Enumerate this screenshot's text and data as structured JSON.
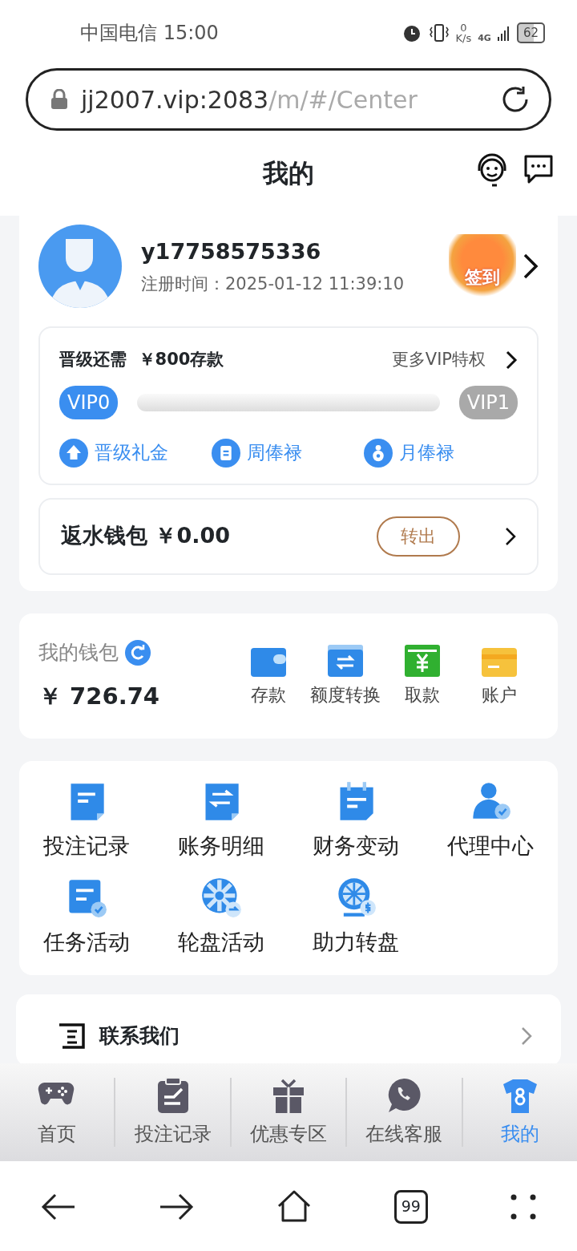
{
  "status_bar": {
    "carrier_time": "中国电信 15:00",
    "net_speed_value": "0",
    "net_speed_unit": "K/s",
    "network": "4G",
    "battery": "62"
  },
  "address_bar": {
    "host": "jj2007.vip:2083",
    "path": "/m/#/Center"
  },
  "header": {
    "title": "我的"
  },
  "profile": {
    "username": "y17758575336",
    "registered": "注册时间：2025-01-12 11:39:10",
    "sign_in": "签到"
  },
  "vip": {
    "need": "晋级还需  ￥800存款",
    "more": "更多VIP特权",
    "current": "VIP0",
    "next": "VIP1",
    "level": 0,
    "perks": [
      {
        "kind": "upgrade",
        "label": "晋级礼金"
      },
      {
        "kind": "weekly",
        "label": "周俸禄"
      },
      {
        "kind": "monthly",
        "label": "月俸禄"
      }
    ]
  },
  "rebate": {
    "label": "返水钱包 ￥0.00",
    "button": "转出"
  },
  "wallet": {
    "title": "我的钱包",
    "balance": "￥ 726.74",
    "actions": [
      {
        "kind": "deposit",
        "label": "存款"
      },
      {
        "kind": "transfer",
        "label": "额度转换"
      },
      {
        "kind": "withdraw",
        "label": "取款"
      },
      {
        "kind": "account",
        "label": "账户"
      }
    ]
  },
  "menu": [
    {
      "kind": "note",
      "label": "投注记录"
    },
    {
      "kind": "swap",
      "label": "账务明细"
    },
    {
      "kind": "calendar",
      "label": "财务变动"
    },
    {
      "kind": "agent",
      "label": "代理中心"
    },
    {
      "kind": "task",
      "label": "任务活动"
    },
    {
      "kind": "wheel",
      "label": "轮盘活动"
    },
    {
      "kind": "prize",
      "label": "助力转盘"
    }
  ],
  "contact": {
    "label": "联系我们"
  },
  "tab_bar": [
    {
      "kind": "gamepad",
      "label": "首页",
      "selected": false
    },
    {
      "kind": "clipboard",
      "label": "投注记录",
      "selected": false
    },
    {
      "kind": "gift",
      "label": "优惠专区",
      "selected": false
    },
    {
      "kind": "chat",
      "label": "在线客服",
      "selected": false
    },
    {
      "kind": "shirt",
      "label": "我的",
      "selected": true
    }
  ],
  "browser_nav": {
    "tab_count": "99"
  }
}
